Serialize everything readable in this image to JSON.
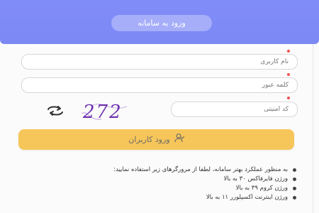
{
  "header": {
    "title": "ورود به سامانه"
  },
  "form": {
    "username_placeholder": "نام کاربری",
    "password_placeholder": "کلمه عبور",
    "captcha_placeholder": "کد امنیتی",
    "captcha_text": "272",
    "login_label": "ورود کاربران"
  },
  "colors": {
    "header": "#818cf8",
    "title_pill": "#a6aef9",
    "login_button": "#f7c65a",
    "required_dot": "#ef5350",
    "captcha_ink": "#6d2fae"
  },
  "notes": [
    "به منظور عملکرد بهتر سامانه، لطفا از مرورگرهای زیر استفاده نمایید:",
    "ورژن فایرفاکس ۳۰ به بالا",
    "ورژن کروم ۳۹ به بالا",
    "ورژن اینترنت اکسپلورر ۱۱ به بالا"
  ],
  "icons": {
    "refresh": "refresh-icon",
    "user": "user-check-icon"
  }
}
